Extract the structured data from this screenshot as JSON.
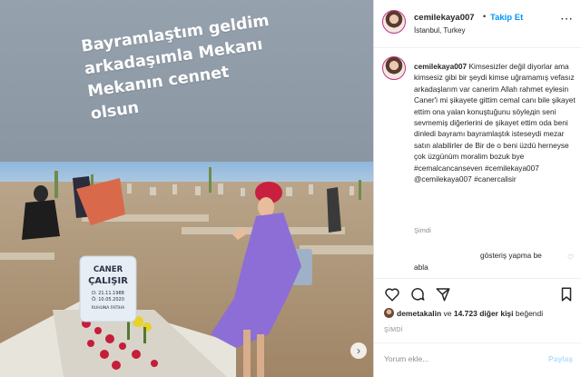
{
  "post_image": {
    "caption_lines": [
      "Bayramlaştım geldim",
      "arkadaşımla Mekanı",
      "Mekanın cennet",
      "olsun"
    ],
    "gravestone": {
      "line1": "CANER",
      "line2": "ÇALIŞIR",
      "line3": "D: 21.11.1988",
      "line4": "Ö: 10.05.2020",
      "line5": "RUHUNA FATİHA"
    }
  },
  "header": {
    "username": "cemilekaya007",
    "separator": "•",
    "follow_label": "Takip Et",
    "location": "İstanbul, Turkey"
  },
  "comment": {
    "username": "cemilekaya007",
    "text": "Kimsesizler değil diyorlar ama kimsesiz gibi bir şeydi kimse uğramamış vefasız arkadaşlarım var canerim Allah rahmet eylesin Caner'i mi şikayete gittim cemal canı bile şikayet ettim ona yalan konuştuğunu söylедin seni sevmemiş diğerlerini de şikayet ettim oda beni dinledi bayramı bayramlaştık isteseydi mezar satın alabilirler de Bir de o beni üzdü herneyse çok üzgünüm moralim bozuk bye #cemalcancanseven #cemilekaya007 @cemilekaya007 #canercalisir",
    "time": "Şimdi"
  },
  "reply": {
    "line1": "gösteriş yapma be",
    "line2": "abla"
  },
  "likes": {
    "user": "demetakalin",
    "middle": " ve ",
    "count": "14.723 diğer kişi",
    "suffix": " beğendi"
  },
  "date": "ŞİMDİ",
  "add_comment": {
    "placeholder": "Yorum ekle...",
    "post_label": "Paylaş"
  },
  "colors": {
    "accent": "#0095f6",
    "text": "#262626",
    "muted": "#8e8e8e",
    "caption_bg": "#8e9aa6"
  }
}
